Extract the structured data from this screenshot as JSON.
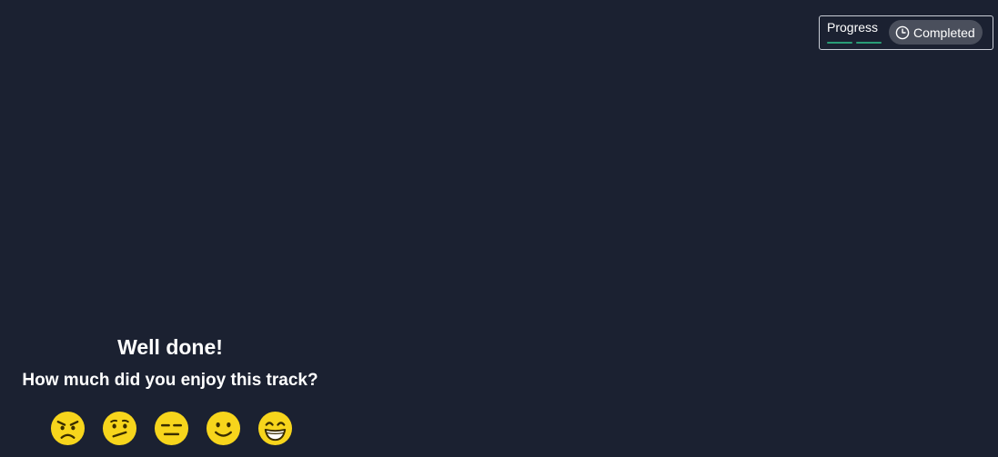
{
  "progress": {
    "label": "Progress",
    "segments_completed": 2,
    "segments_total": 2,
    "accent_color": "#2a9d77",
    "status_text": "Completed",
    "status_icon": "clock-icon"
  },
  "feedback": {
    "title": "Well done!",
    "question": "How much did you enjoy this track?",
    "ratings": [
      {
        "name": "angry-face-icon",
        "meaning": "angry"
      },
      {
        "name": "confused-face-icon",
        "meaning": "confused"
      },
      {
        "name": "expressionless-face-icon",
        "meaning": "neutral"
      },
      {
        "name": "slightly-smiling-face-icon",
        "meaning": "happy"
      },
      {
        "name": "grinning-face-icon",
        "meaning": "very happy"
      }
    ],
    "emoji_color": "#f7d51c"
  },
  "colors": {
    "background": "#1b2131",
    "pill_background": "#4a4f5c",
    "widget_border": "#c9cdd6"
  }
}
